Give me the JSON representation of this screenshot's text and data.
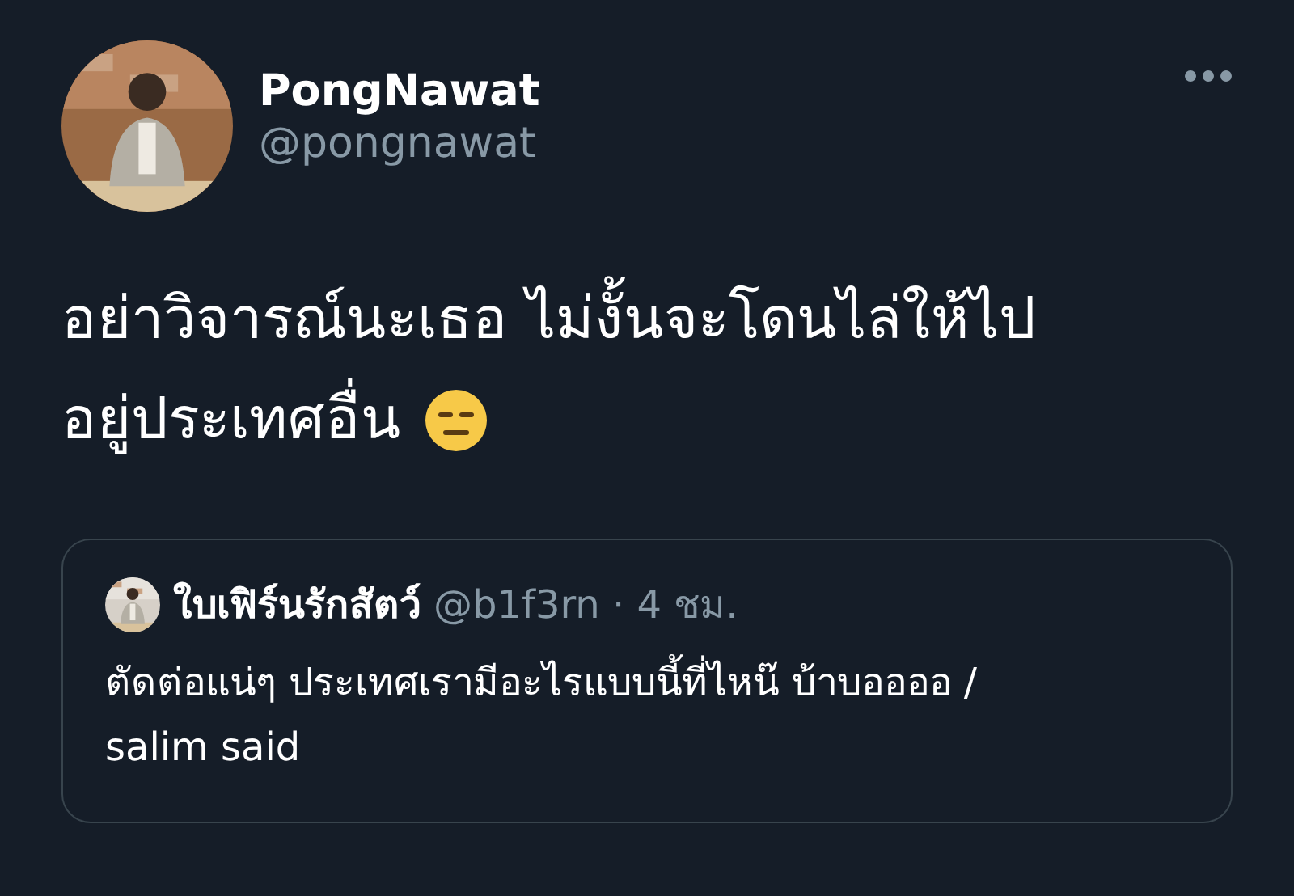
{
  "tweet": {
    "author": {
      "name": "PongNawat",
      "handle": "@pongnawat"
    },
    "text_lines": [
      "อย่าวิจารณ์นะเธอ ไม่งั้นจะโดนไล่ให้ไป",
      "อยู่ประเทศอื่น"
    ],
    "quoted": {
      "name": "ใบเฟิร์นรักสัตว์",
      "meta": "@b1f3rn · 4 ชม.",
      "text": "ตัดต่อแน่ๆ ประเทศเรามีอะไรแบบนี้ที่ไหน๊ บ้าบออออ / salim said"
    }
  }
}
